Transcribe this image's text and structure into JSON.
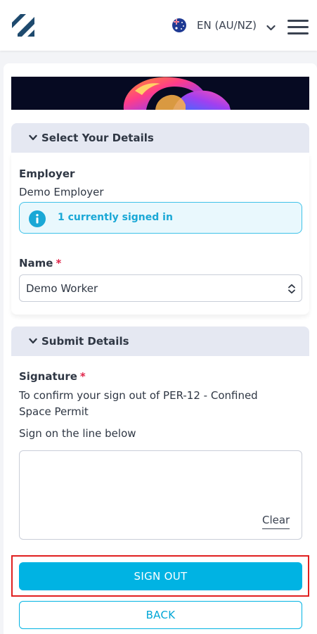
{
  "header": {
    "language": "EN (AU/NZ)"
  },
  "colors": {
    "accent": "#00b3e3",
    "required": "#e0254a",
    "info_text": "#1aa8d6",
    "section_header_bg": "#e5e8f2"
  },
  "section_details": {
    "title": "Select Your Details",
    "employer_label": "Employer",
    "employer_value": "Demo Employer",
    "info_message": "1 currently signed in",
    "name_label": "Name",
    "required_marker": "*",
    "name_value": "Demo Worker"
  },
  "section_submit": {
    "title": "Submit Details",
    "signature_label": "Signature",
    "required_marker": "*",
    "confirm_line1": "To confirm your sign out of PER-12 - Confined",
    "confirm_line2": "Space Permit",
    "instruction": "Sign on the line below",
    "clear_label": "Clear"
  },
  "actions": {
    "sign_out_label": "SIGN OUT",
    "back_label": "BACK"
  }
}
